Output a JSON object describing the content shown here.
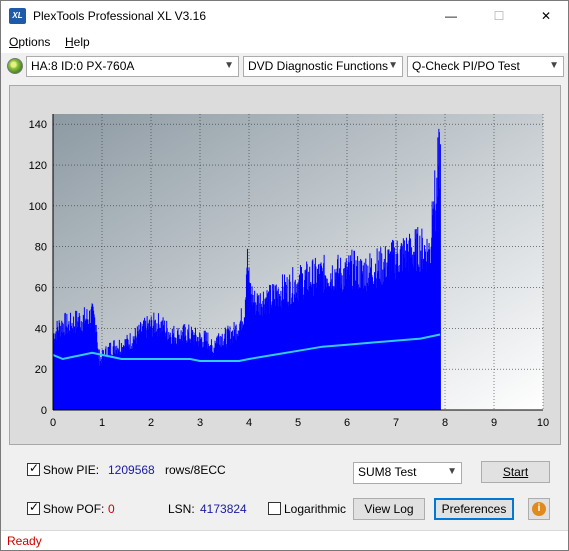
{
  "window": {
    "title": "PlexTools Professional XL V3.16",
    "icon_label": "XL"
  },
  "title_buttons": {
    "minimize": "—",
    "maximize": "☐",
    "close": "✕"
  },
  "menu": {
    "options_u": "O",
    "options_rest": "ptions",
    "help_u": "H",
    "help_rest": "elp"
  },
  "toolbar": {
    "drive": "HA:8 ID:0  PX-760A",
    "function": "DVD Diagnostic Functions",
    "test": "Q-Check PI/PO Test",
    "arrow": "⌵"
  },
  "chart_data": {
    "type": "area",
    "x_ticks": [
      "0",
      "1",
      "2",
      "3",
      "4",
      "5",
      "6",
      "7",
      "8",
      "9",
      "10"
    ],
    "y_ticks": [
      "0",
      "20",
      "40",
      "60",
      "80",
      "100",
      "120",
      "140"
    ],
    "xlim": [
      0,
      10
    ],
    "ylim": [
      0,
      145
    ],
    "grid": true,
    "series": [
      {
        "kind": "PIE bars",
        "color": "#0000ff",
        "points": [
          [
            0,
            38
          ],
          [
            0.1,
            42
          ],
          [
            0.2,
            44
          ],
          [
            0.3,
            43
          ],
          [
            0.4,
            44
          ],
          [
            0.5,
            46
          ],
          [
            0.6,
            46
          ],
          [
            0.7,
            47
          ],
          [
            0.8,
            48
          ],
          [
            0.88,
            45
          ],
          [
            0.9,
            30
          ],
          [
            0.95,
            26
          ],
          [
            1.0,
            27
          ],
          [
            1.1,
            30
          ],
          [
            1.2,
            32
          ],
          [
            1.3,
            33
          ],
          [
            1.4,
            33
          ],
          [
            1.5,
            34
          ],
          [
            1.6,
            36
          ],
          [
            1.7,
            38
          ],
          [
            1.8,
            40
          ],
          [
            1.9,
            42
          ],
          [
            2.0,
            43
          ],
          [
            2.1,
            44
          ],
          [
            2.2,
            43
          ],
          [
            2.3,
            41
          ],
          [
            2.4,
            39
          ],
          [
            2.5,
            38
          ],
          [
            2.6,
            38
          ],
          [
            2.7,
            39
          ],
          [
            2.8,
            38
          ],
          [
            2.9,
            37
          ],
          [
            3.0,
            36
          ],
          [
            3.1,
            36
          ],
          [
            3.2,
            35
          ],
          [
            3.25,
            28
          ],
          [
            3.3,
            36
          ],
          [
            3.4,
            38
          ],
          [
            3.5,
            37
          ],
          [
            3.6,
            38
          ],
          [
            3.7,
            40
          ],
          [
            3.8,
            44
          ],
          [
            3.9,
            50
          ],
          [
            3.95,
            78
          ],
          [
            4.0,
            62
          ],
          [
            4.1,
            55
          ],
          [
            4.2,
            55
          ],
          [
            4.3,
            57
          ],
          [
            4.4,
            56
          ],
          [
            4.5,
            58
          ],
          [
            4.6,
            60
          ],
          [
            4.7,
            61
          ],
          [
            4.8,
            62
          ],
          [
            4.9,
            64
          ],
          [
            5.0,
            65
          ],
          [
            5.1,
            66
          ],
          [
            5.2,
            67
          ],
          [
            5.3,
            68
          ],
          [
            5.4,
            68
          ],
          [
            5.5,
            69
          ],
          [
            5.6,
            70
          ],
          [
            5.7,
            70
          ],
          [
            5.8,
            70
          ],
          [
            5.9,
            69
          ],
          [
            6.0,
            70
          ],
          [
            6.1,
            72
          ],
          [
            6.2,
            70
          ],
          [
            6.3,
            70
          ],
          [
            6.4,
            71
          ],
          [
            6.5,
            72
          ],
          [
            6.6,
            73
          ],
          [
            6.7,
            73
          ],
          [
            6.8,
            75
          ],
          [
            6.9,
            76
          ],
          [
            7.0,
            78
          ],
          [
            7.1,
            79
          ],
          [
            7.2,
            80
          ],
          [
            7.3,
            80
          ],
          [
            7.4,
            82
          ],
          [
            7.5,
            82
          ],
          [
            7.6,
            81
          ],
          [
            7.7,
            81
          ],
          [
            7.75,
            120
          ],
          [
            7.8,
            100
          ],
          [
            7.85,
            125
          ],
          [
            7.9,
            128
          ],
          [
            7.92,
            0
          ]
        ]
      },
      {
        "kind": "PIF line",
        "color": "#33ccee",
        "points": [
          [
            0,
            27
          ],
          [
            0.2,
            25
          ],
          [
            0.4,
            26
          ],
          [
            0.6,
            27
          ],
          [
            0.8,
            28
          ],
          [
            1.0,
            27
          ],
          [
            1.2,
            26
          ],
          [
            1.4,
            25
          ],
          [
            1.6,
            25
          ],
          [
            1.8,
            25
          ],
          [
            2.0,
            25
          ],
          [
            2.2,
            25
          ],
          [
            2.4,
            25
          ],
          [
            2.6,
            25
          ],
          [
            2.8,
            25
          ],
          [
            3.0,
            24
          ],
          [
            3.2,
            24
          ],
          [
            3.4,
            24
          ],
          [
            3.6,
            24
          ],
          [
            3.8,
            24
          ],
          [
            4.0,
            25
          ],
          [
            4.5,
            27
          ],
          [
            5.0,
            29
          ],
          [
            5.5,
            31
          ],
          [
            6.0,
            32
          ],
          [
            6.5,
            33
          ],
          [
            7.0,
            34
          ],
          [
            7.5,
            35
          ],
          [
            7.9,
            37
          ]
        ]
      }
    ]
  },
  "controls": {
    "show_pie_label": "Show PIE:",
    "pie_value": "1209568",
    "rows_unit": "rows/8ECC",
    "show_pof_label": "Show POF:",
    "pof_value": "0",
    "lsn_label": "LSN:",
    "lsn_value": "4173824",
    "log_label": "Logarithmic",
    "sum_select": "SUM8 Test",
    "start": "Start",
    "view_log": "View Log",
    "preferences": "Preferences",
    "info": "i",
    "tick": "✓"
  },
  "status": {
    "text": "Ready"
  }
}
